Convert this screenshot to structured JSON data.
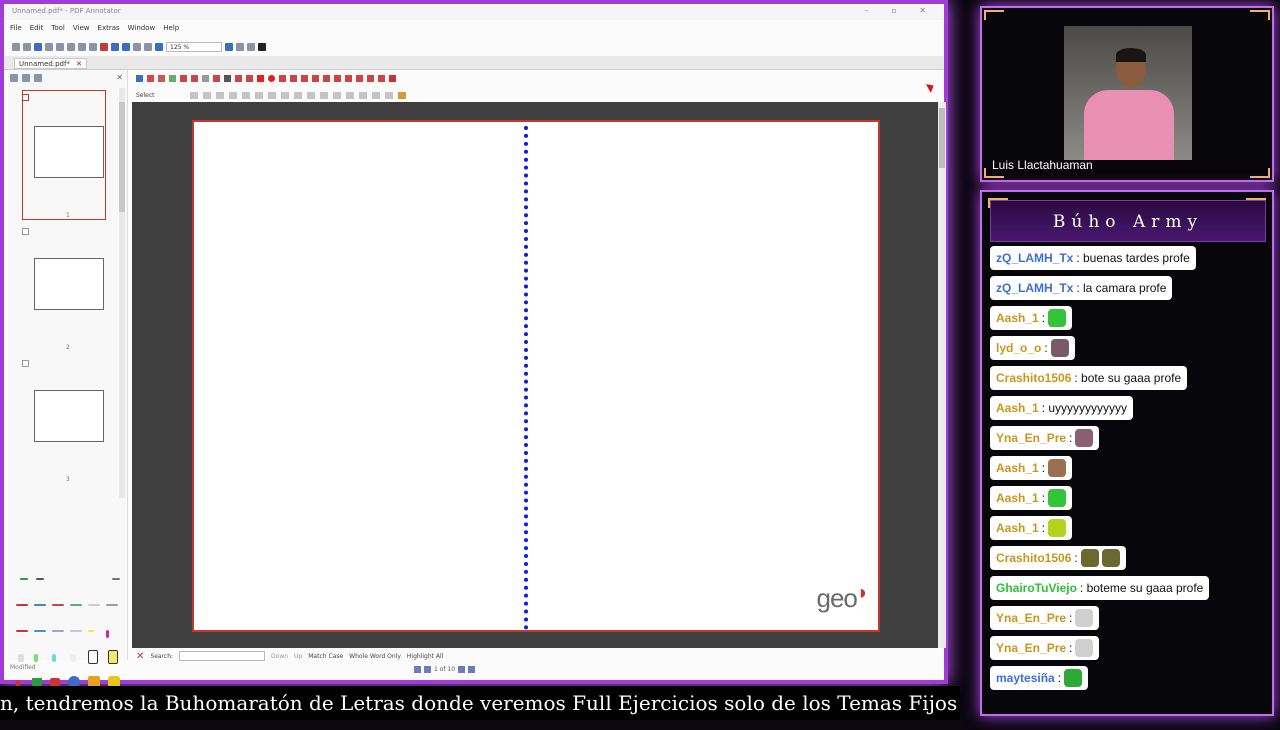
{
  "window": {
    "title": "Unnamed.pdf* - PDF Annotator",
    "controls": "– ▫ ✕"
  },
  "menu": [
    "File",
    "Edit",
    "Tool",
    "View",
    "Extras",
    "Window",
    "Help"
  ],
  "toolbar": {
    "zoom": "125 %"
  },
  "tab": {
    "label": "Unnamed.pdf*",
    "close": "✕"
  },
  "toolbar3": {
    "select_label": "Select"
  },
  "thumbnails": [
    {
      "number": "1"
    },
    {
      "number": "2"
    },
    {
      "number": "3"
    }
  ],
  "document": {
    "watermark": "geo"
  },
  "search": {
    "close": "✕",
    "label": "Search:",
    "value": "",
    "down": "Down",
    "up": "Up",
    "match_case": "Match Case",
    "whole_word": "Whole Word Only",
    "highlight": "Highlight All"
  },
  "status": {
    "left": "Modified",
    "page": "1 of 10"
  },
  "ticker": {
    "text": "n, tendremos la Buhomaratón de Letras donde veremos Full Ejercicios solo de los Temas Fijos ♡"
  },
  "webcam": {
    "name": "Luis Llactahuaman"
  },
  "chat": {
    "title": "Búho Army",
    "messages": [
      {
        "user": "zQ_LAMH_Tx",
        "text": ": buenas tardes profe",
        "user_color": "#3b6fd6",
        "emotes": []
      },
      {
        "user": "zQ_LAMH_Tx",
        "text": ": la camara profe",
        "user_color": "#3b6fd6",
        "emotes": []
      },
      {
        "user": "Aash_1",
        "text": ":",
        "user_color": "#c8961e",
        "emotes": [
          "#33c43a"
        ]
      },
      {
        "user": "lyd_o_o",
        "text": ":",
        "user_color": "#c8961e",
        "emotes": [
          "#7a5a66"
        ]
      },
      {
        "user": "Crashito1506",
        "text": ": bote su gaaa profe",
        "user_color": "#c8961e",
        "emotes": []
      },
      {
        "user": "Aash_1",
        "text": ": uyyyyyyyyyyyy",
        "user_color": "#c8961e",
        "emotes": []
      },
      {
        "user": "Yna_En_Pre",
        "text": ":",
        "user_color": "#c8961e",
        "emotes": [
          "#8a6070"
        ]
      },
      {
        "user": "Aash_1",
        "text": ":",
        "user_color": "#c8961e",
        "emotes": [
          "#9a7050"
        ]
      },
      {
        "user": "Aash_1",
        "text": ":",
        "user_color": "#c8961e",
        "emotes": [
          "#33c43a"
        ]
      },
      {
        "user": "Aash_1",
        "text": ":",
        "user_color": "#c8961e",
        "emotes": [
          "#b6d21e"
        ]
      },
      {
        "user": "Crashito1506",
        "text": ":",
        "user_color": "#c8961e",
        "emotes": [
          "#6a6a30",
          "#6a6a30"
        ]
      },
      {
        "user": "GhairoTuViejo",
        "text": ": boteme su gaaa profe",
        "user_color": "#2fbf3a",
        "emotes": []
      },
      {
        "user": "Yna_En_Pre",
        "text": ":",
        "user_color": "#c8961e",
        "emotes": [
          "#d0d0d0"
        ]
      },
      {
        "user": "Yna_En_Pre",
        "text": ":",
        "user_color": "#c8961e",
        "emotes": [
          "#d0d0d0"
        ]
      },
      {
        "user": "maytesiña",
        "text": ":",
        "user_color": "#3b6fd6",
        "emotes": [
          "#2fa83a"
        ]
      }
    ]
  },
  "colors": {
    "accent": "#a23cd6",
    "page_border": "#c0392b",
    "fold_line": "#0a1fd8"
  }
}
